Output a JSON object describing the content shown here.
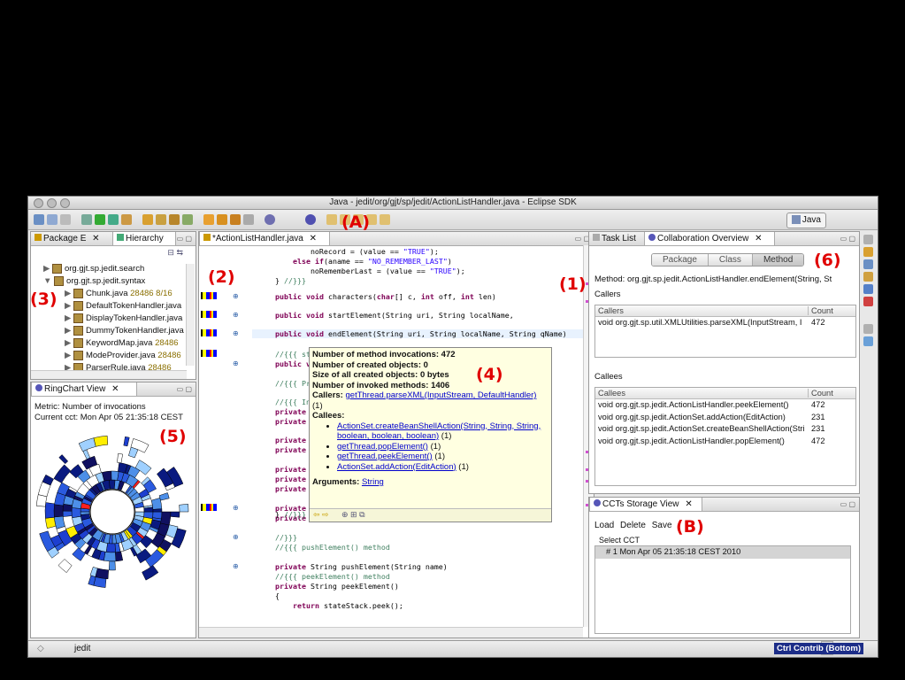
{
  "window": {
    "title": "Java - jedit/org/gjt/sp/jedit/ActionListHandler.java - Eclipse SDK"
  },
  "toolbar": {
    "perspective": "Java"
  },
  "annotations": {
    "A": "(A)",
    "B": "(B)",
    "one": "(1)",
    "two": "(2)",
    "three": "(3)",
    "four": "(4)",
    "five": "(5)",
    "six": "(6)"
  },
  "package_explorer": {
    "tab1": "Package E",
    "tab2": "Hierarchy",
    "items": [
      {
        "label": "org.gjt.sp.jedit.search",
        "num": ""
      },
      {
        "label": "org.gjt.sp.jedit.syntax",
        "num": ""
      },
      {
        "label": "Chunk.java",
        "num": "28486 8/16"
      },
      {
        "label": "DefaultTokenHandler.java",
        "num": ""
      },
      {
        "label": "DisplayTokenHandler.java",
        "num": ""
      },
      {
        "label": "DummyTokenHandler.java",
        "num": ""
      },
      {
        "label": "KeywordMap.java",
        "num": "28486"
      },
      {
        "label": "ModeProvider.java",
        "num": "28486"
      },
      {
        "label": "ParserRule.java",
        "num": "28486"
      }
    ]
  },
  "ringchart": {
    "tab": "RingChart View",
    "metric": "Metric: Number of invocations",
    "current_cct": "Current cct: Mon Apr 05 21:35:18 CEST"
  },
  "editor": {
    "tab": "*ActionListHandler.java",
    "lines": [
      "            noRecord = (value == \"TRUE\");",
      "        else if(aname == \"NO_REMEMBER_LAST\")",
      "            noRememberLast = (value == \"TRUE\");",
      "    } //}}}",
      "    public void characters(char[] c, int off, int len)",
      "    public void startElement(String uri, String localName,",
      "    public void endElement(String uri, String localName, String qName)",
      "    //{{{ startD",
      "    public void",
      "    //{{{ Privat",
      "    //{{{ Instan",
      "    private Strin",
      "    private JEdit",
      "    private Strin",
      "    private final",
      "    private final",
      "    private boole",
      "    private boole",
      "    private boole",
      "    private final Stack<String> stateStack;",
      "    //}}}",
      "    //{{{ pushElement() method",
      "    private String pushElement(String name)",
      "    //{{{ peekElement() method",
      "    private String peekElement()",
      "    {",
      "        return stateStack.peek();",
      "    } //}}}"
    ]
  },
  "hover": {
    "invocations": "Number of method invocations: 472",
    "created": "Number of created objects: 0",
    "size": "Size of all created objects: 0 bytes",
    "invoked": "Number of invoked methods: 1406",
    "callers_label": "Callers:",
    "caller_link": "getThread.parseXML(InputStream, DefaultHandler)",
    "caller_count": "(1)",
    "callees_label": "Callees:",
    "callees": [
      {
        "link": "ActionSet.createBeanShellAction(String, String, String, boolean, boolean, boolean)",
        "count": "(1)"
      },
      {
        "link": "getThread.popElement()",
        "count": "(1)"
      },
      {
        "link": "getThread.peekElement()",
        "count": "(1)"
      },
      {
        "link": "ActionSet.addAction(EditAction)",
        "count": "(1)"
      }
    ],
    "arguments_label": "Arguments:",
    "argument": "String"
  },
  "collab": {
    "tab1": "Task List",
    "tab2": "Collaboration Overview",
    "seg": [
      "Package",
      "Class",
      "Method"
    ],
    "method": "Method: org.gjt.sp.jedit.ActionListHandler.endElement(String, St",
    "callers_title": "Callers",
    "callers_head": [
      "Callers",
      "Count"
    ],
    "callers_rows": [
      {
        "name": "void org.gjt.sp.util.XMLUtilities.parseXML(InputStream, I",
        "count": "472"
      }
    ],
    "callees_title": "Callees",
    "callees_head": [
      "Callees",
      "Count"
    ],
    "callees_rows": [
      {
        "name": "void org.gjt.sp.jedit.ActionListHandler.peekElement()",
        "count": "472"
      },
      {
        "name": "void org.gjt.sp.jedit.ActionSet.addAction(EditAction)",
        "count": "231"
      },
      {
        "name": "void org.gjt.sp.jedit.ActionSet.createBeanShellAction(Stri",
        "count": "231"
      },
      {
        "name": "void org.gjt.sp.jedit.ActionListHandler.popElement()",
        "count": "472"
      }
    ]
  },
  "ccts": {
    "tab": "CCTs Storage View",
    "load": "Load",
    "delete": "Delete",
    "save": "Save",
    "select_label": "Select CCT",
    "row": "# 1 Mon Apr 05 21:35:18 CEST 2010"
  },
  "status": {
    "project": "jedit",
    "contrib": "Ctrl Contrib (Bottom)"
  }
}
